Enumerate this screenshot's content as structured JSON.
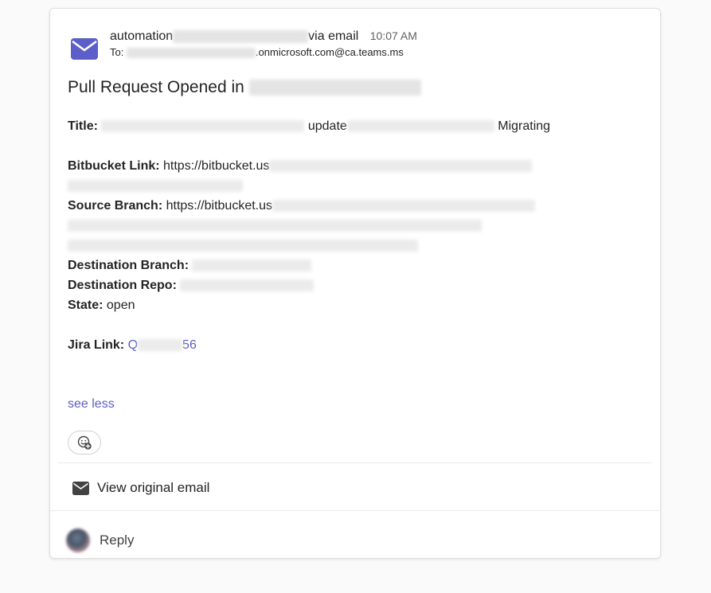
{
  "email": {
    "sender_prefix": "automation",
    "via_text": "via email",
    "time": "10:07 AM",
    "to_label": "To:",
    "to_suffix": ".onmicrosoft.com@ca.teams.ms",
    "subject_prefix": "Pull Request Opened in"
  },
  "fields": {
    "title_label": "Title:",
    "title_mid": "update",
    "title_suffix": "Migrating",
    "bitbucket_label": "Bitbucket Link:",
    "bitbucket_value": "https://bitbucket.us",
    "source_label": "Source Branch:",
    "source_value": "https://bitbucket.us",
    "destination_branch_label": "Destination Branch:",
    "destination_repo_label": "Destination Repo:",
    "state_label": "State:",
    "state_value": "open",
    "jira_label": "Jira Link:",
    "jira_prefix": "Q",
    "jira_suffix": "56"
  },
  "actions": {
    "see_less": "see less",
    "view_original": "View original email",
    "reply": "Reply"
  },
  "icons": {
    "mail": "mail-icon",
    "reaction": "add-reaction-icon",
    "envelope": "envelope-icon"
  },
  "colors": {
    "accent": "#5b5fc7",
    "text": "#242424"
  }
}
